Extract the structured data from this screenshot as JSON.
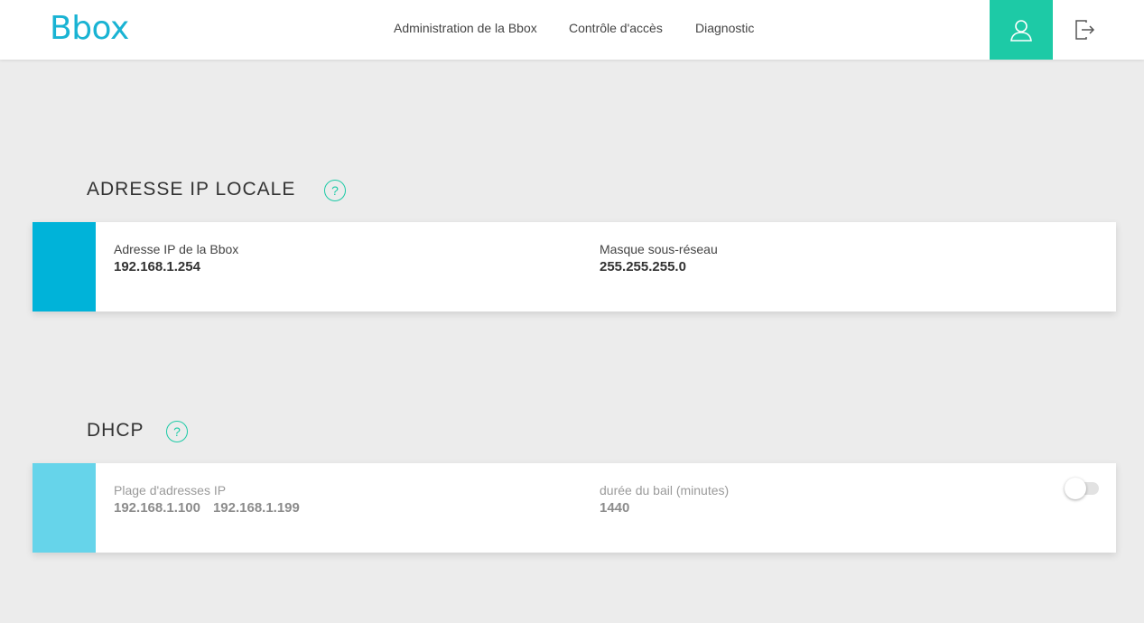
{
  "header": {
    "logo": "Bbox",
    "nav": [
      {
        "label": "Administration de la Bbox"
      },
      {
        "label": "Contrôle d'accès"
      },
      {
        "label": "Diagnostic"
      }
    ],
    "user_icon": "user-icon",
    "logout_icon": "logout-icon"
  },
  "colors": {
    "brand": "#19b3d3",
    "accent": "#1dcaa6",
    "card_bar_active": "#00b3d9",
    "card_bar_disabled": "#66d4ea"
  },
  "sections": {
    "local_ip": {
      "title": "ADRESSE IP LOCALE",
      "help": "?",
      "fields": [
        {
          "label": "Adresse IP de la Bbox",
          "value": "192.168.1.254"
        },
        {
          "label": "Masque sous-réseau",
          "value": "255.255.255.0"
        }
      ]
    },
    "dhcp": {
      "title": "DHCP",
      "help": "?",
      "range_label": "Plage d'adresses IP",
      "range_start": "192.168.1.100",
      "range_end": "192.168.1.199",
      "lease_label": "durée du bail (minutes)",
      "lease_value": "1440",
      "enabled": false
    }
  }
}
